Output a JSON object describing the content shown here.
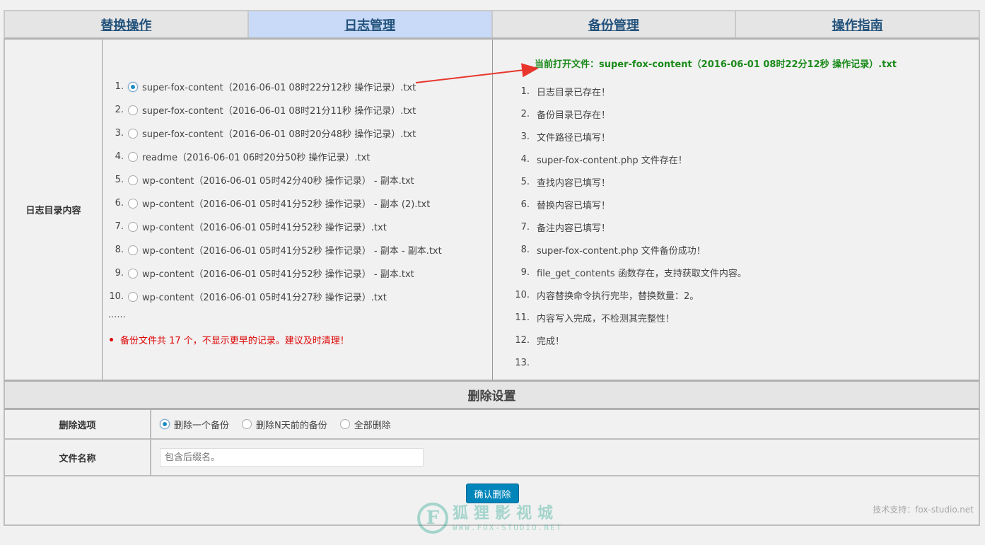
{
  "tabs": [
    {
      "label": "替换操作"
    },
    {
      "label": "日志管理"
    },
    {
      "label": "备份管理"
    },
    {
      "label": "操作指南"
    }
  ],
  "log": {
    "section_label": "日志目录内容",
    "files": [
      {
        "num": "1.",
        "name": "super-fox-content（2016-06-01 08时22分12秒 操作记录）.txt"
      },
      {
        "num": "2.",
        "name": "super-fox-content（2016-06-01 08时21分11秒 操作记录）.txt"
      },
      {
        "num": "3.",
        "name": "super-fox-content（2016-06-01 08时20分48秒 操作记录）.txt"
      },
      {
        "num": "4.",
        "name": "readme（2016-06-01 06时20分50秒 操作记录）.txt"
      },
      {
        "num": "5.",
        "name": "wp-content（2016-06-01 05时42分40秒 操作记录） - 副本.txt"
      },
      {
        "num": "6.",
        "name": "wp-content（2016-06-01 05时41分52秒 操作记录） - 副本 (2).txt"
      },
      {
        "num": "7.",
        "name": "wp-content（2016-06-01 05时41分52秒 操作记录）.txt"
      },
      {
        "num": "8.",
        "name": "wp-content（2016-06-01 05时41分52秒 操作记录） - 副本 - 副本.txt"
      },
      {
        "num": "9.",
        "name": "wp-content（2016-06-01 05时41分52秒 操作记录） - 副本.txt"
      },
      {
        "num": "10.",
        "name": "wp-content（2016-06-01 05时41分27秒 操作记录）.txt"
      }
    ],
    "ellipsis": "......",
    "warning": "备份文件共 17 个，不显示更早的记录。建议及时清理！",
    "current_file": "当前打开文件：super-fox-content（2016-06-01 08时22分12秒 操作记录）.txt",
    "steps": [
      {
        "num": "1.",
        "text": "日志目录已存在！"
      },
      {
        "num": "2.",
        "text": "备份目录已存在！"
      },
      {
        "num": "3.",
        "text": "文件路径已填写！"
      },
      {
        "num": "4.",
        "text": "super-fox-content.php 文件存在！"
      },
      {
        "num": "5.",
        "text": "查找内容已填写！"
      },
      {
        "num": "6.",
        "text": "替换内容已填写！"
      },
      {
        "num": "7.",
        "text": "备注内容已填写！"
      },
      {
        "num": "8.",
        "text": "super-fox-content.php 文件备份成功！"
      },
      {
        "num": "9.",
        "text": "file_get_contents 函数存在，支持获取文件内容。"
      },
      {
        "num": "10.",
        "text": "内容替换命令执行完毕，替换数量：2。"
      },
      {
        "num": "11.",
        "text": "内容写入完成，不检测其完整性！"
      },
      {
        "num": "12.",
        "text": "完成！"
      },
      {
        "num": "13.",
        "text": ""
      }
    ]
  },
  "delete": {
    "header": "删除设置",
    "options_label": "删除选项",
    "options": [
      {
        "label": "删除一个备份",
        "checked": true
      },
      {
        "label": "删除N天前的备份",
        "checked": false
      },
      {
        "label": "全部删除",
        "checked": false
      }
    ],
    "filename_label": "文件名称",
    "filename_placeholder": "包含后缀名。",
    "confirm_label": "确认删除",
    "support_text": "技术支持：fox-studio.net"
  },
  "watermark": {
    "logo": "F",
    "cn": "狐狸影视城",
    "en": "WWW.FOX-STUDIO.NET"
  }
}
